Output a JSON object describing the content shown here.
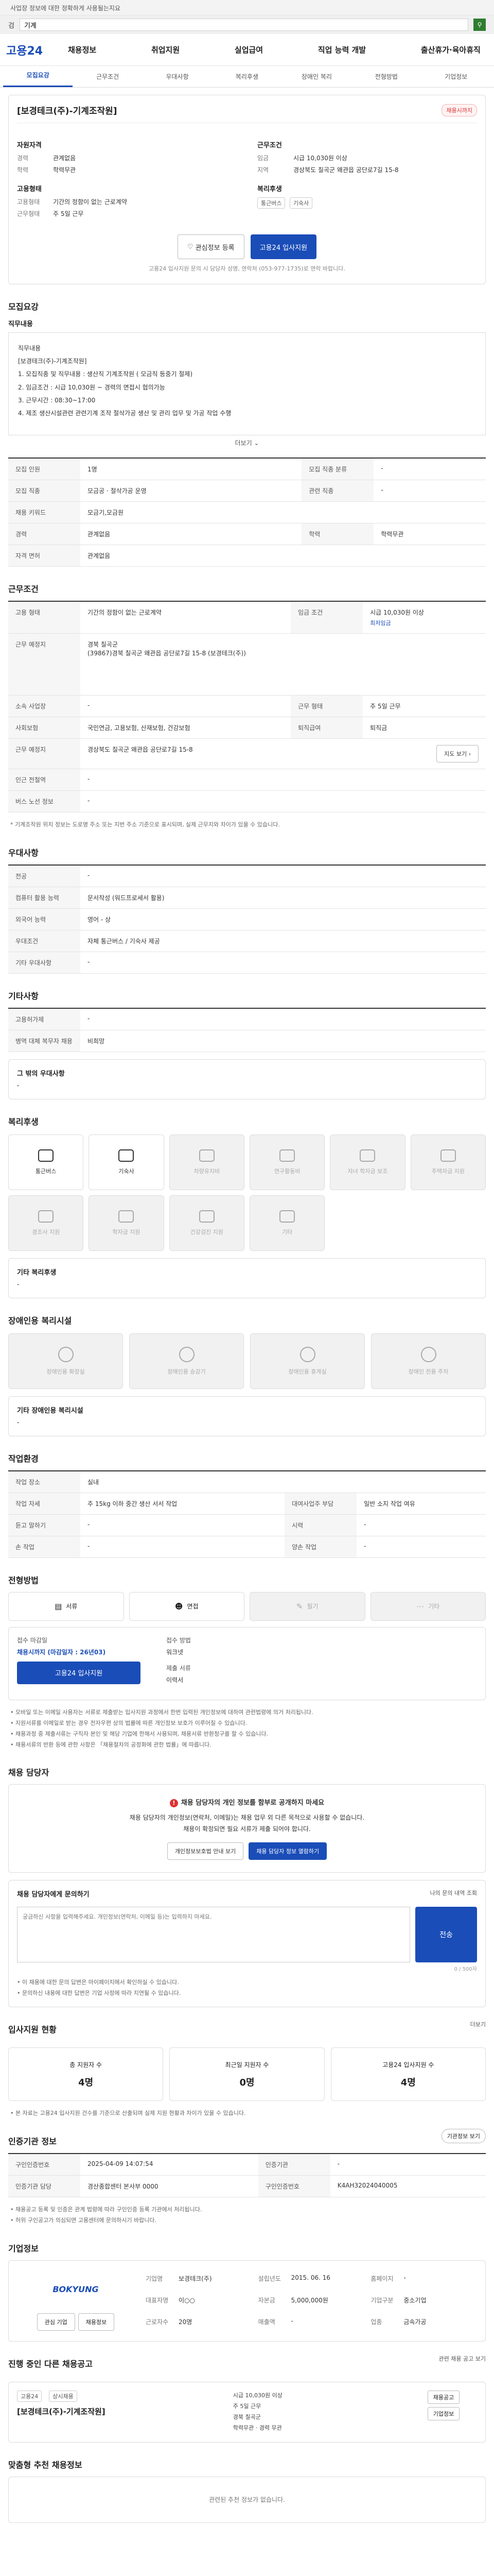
{
  "banner": {
    "text": "사업장 정보에 대한 정확하게 사용될는지요"
  },
  "search": {
    "label": "검",
    "value": "기계",
    "icon": "magnifier-icon"
  },
  "header": {
    "logo": "고용24",
    "menu": [
      "채용정보",
      "취업지원",
      "실업급여",
      "직업 능력 개발",
      "출산휴가·육아휴직"
    ]
  },
  "tabs": [
    "모집요강",
    "근무조건",
    "우대사항",
    "복리후생",
    "장애인 복리",
    "전형방법",
    "기업정보"
  ],
  "summary": {
    "title": "[보경테크(주)-기계조작원]",
    "deadline": "채용시까지",
    "left_heading": "자원자격",
    "left_rows": [
      {
        "k": "경력",
        "v": "관계없음"
      },
      {
        "k": "학력",
        "v": "학력무관"
      }
    ],
    "left_heading2": "고용형태",
    "left_rows2": [
      {
        "k": "고용형태",
        "v": "기간의 정함이 없는 근로계약"
      },
      {
        "k": "근무형태",
        "v": "주 5일 근무"
      }
    ],
    "right_heading": "근무조건",
    "right_rows": [
      {
        "k": "임금",
        "v": "시급 10,030원 이상"
      },
      {
        "k": "지역",
        "v": "경상북도 칠곡군 왜관읍 공단로7길 15-8"
      }
    ],
    "right_heading2": "복리후생",
    "badges": [
      "통근버스",
      "기숙사"
    ],
    "btn_scrap": "관심정보 등록",
    "btn_apply": "고용24 입사지원",
    "note": "고용24 입사지원 문의 시 담당자 성명, 연락처 (053-977-1735)로 연락 바랍니다."
  },
  "recruit": {
    "title": "모집요강",
    "sub": "직무내용",
    "lines": [
      "직무내용",
      "[보경테크(주)-기계조작원]",
      "1. 모집직종 및 직무내용 : 생산직 기계조작원 ( 모금직 등중기 절제)",
      "2. 임금조건 : 시급 10,030원 ~ 경력의 면접시 협의가능",
      "3. 근무시간 : 08:30~17:00",
      "4. 제조 생산시설관련 관련기계 조작 절삭가공 생산 및 관리 업무 및 가공 작업 수행"
    ],
    "more": "더보기",
    "table": [
      {
        "k1": "모집 인원",
        "v1": "1명",
        "k2": "모집 직종 분류",
        "v2": "-"
      },
      {
        "k1": "모집 직종",
        "v1": "모금공 · 절삭가공 운영",
        "k2": "관련 직종",
        "v2": "-"
      },
      {
        "k1": "채용 키워드",
        "v1": "모금기,모금원",
        "k2": "",
        "v2": ""
      },
      {
        "k1": "경력",
        "v1": "관계없음",
        "k2": "학력",
        "v2": "학력무관"
      },
      {
        "k1": "자격 면허",
        "v1": "관계없음",
        "k2": "",
        "v2": ""
      }
    ]
  },
  "work": {
    "title": "근무조건",
    "table": [
      {
        "k1": "고용 형태",
        "v1": "기간의 정함이 없는 근로계약",
        "k2": "임금 조건",
        "v2": "시급 10,030원 이상",
        "v2b": "최저임금"
      },
      {
        "k1": "근무 예정지",
        "v1": "경북 칠곡군\n(39867)경북 칠곡군 왜관읍 공단로7길 15-8 (보경테크(주))",
        "k2": "",
        "v2": "",
        "v2b": ""
      },
      {
        "k1": "소속 사업장",
        "v1": "-",
        "k2": "근무 형태",
        "v2": "주 5일 근무",
        "v2b": ""
      },
      {
        "k1": "사회보험",
        "v1": "국민연금, 고용보험, 산재보험, 건강보험",
        "k2": "퇴직급여",
        "v2": "퇴직금",
        "v2b": ""
      },
      {
        "k1": "근무 예정지",
        "v1": "경상북도 칠곡군 왜관읍 공단로7길 15-8",
        "k2": "",
        "v2": "",
        "v2b": ""
      },
      {
        "k1": "인근 전철역",
        "v1": "-",
        "k2": "",
        "v2": "",
        "v2b": ""
      },
      {
        "k1": "버스 노선 정보",
        "v1": "-",
        "k2": "",
        "v2": "",
        "v2b": ""
      }
    ],
    "map_btn": "지도 보기",
    "footnote": "* 기계조작원 위치 정보는 도로명 주소 또는 지번 주소 기준으로 표시되며, 실제 근무지와 차이가 있을 수 있습니다."
  },
  "prefer": {
    "title": "우대사항",
    "table": [
      {
        "k": "전공",
        "v": "-"
      },
      {
        "k": "컴퓨터 활용 능력",
        "v": "문서작성 (워드프로세서 활용)"
      },
      {
        "k": "외국어 능력",
        "v": "영어 - 상"
      },
      {
        "k": "우대조건",
        "v": "자체 통근버스 / 기숙사 제공"
      },
      {
        "k": "기타 우대사항",
        "v": "-"
      }
    ]
  },
  "extra": {
    "title": "기타사항",
    "table": [
      {
        "k": "고용허가제",
        "v": "-"
      },
      {
        "k": "병역 대체 복무자 채용",
        "v": "비희망"
      }
    ],
    "more_title": "그 밖의 우대사항",
    "more_value": "-"
  },
  "benefits": {
    "title": "복리후생",
    "items": [
      {
        "label": "통근버스",
        "on": true
      },
      {
        "label": "기숙사",
        "on": true
      },
      {
        "label": "차량유지비",
        "on": false
      },
      {
        "label": "연구활동비",
        "on": false
      },
      {
        "label": "자녀 학자금 보조",
        "on": false
      },
      {
        "label": "주택자금 지원",
        "on": false
      },
      {
        "label": "경조사 지원",
        "on": false
      },
      {
        "label": "학자금 지원",
        "on": false
      },
      {
        "label": "건강검진 지원",
        "on": false
      },
      {
        "label": "기타",
        "on": false
      }
    ],
    "detail_title": "기타 복리후생",
    "detail_value": "-"
  },
  "disability": {
    "title": "장애인용 복리시설",
    "items": [
      "장애인용 화장실",
      "장애인용 승강기",
      "장애인용 휴게실",
      "장애인 전용 주차"
    ],
    "detail_title": "기타 장애인용 복리시설",
    "detail_value": "-"
  },
  "env": {
    "title": "작업환경",
    "table": [
      {
        "k1": "작업 장소",
        "v1": "실내",
        "k2": "",
        "v2": ""
      },
      {
        "k1": "작업 자세",
        "v1": "주 15kg 이하 중간 생산 서서 작업",
        "k2": "",
        "v2": ""
      },
      {
        "k1": "듣고 말하기",
        "v1": "-",
        "k2": "시력",
        "v2": "-"
      },
      {
        "k1": "손 작업",
        "v1": "-",
        "k2": "양손 작업",
        "v2": "-"
      }
    ],
    "right_rows": [
      {
        "k": "대여사업주 부담",
        "v": "일반 소지 작업 여유"
      }
    ]
  },
  "selection": {
    "title": "전형방법",
    "methods": [
      {
        "label": "서류",
        "icon": "document-icon",
        "on": true
      },
      {
        "label": "면접",
        "icon": "person-icon",
        "on": true
      },
      {
        "label": "필기",
        "icon": "pencil-icon",
        "on": false
      },
      {
        "label": "기타",
        "icon": "dots-icon",
        "on": false
      }
    ],
    "apply_label1": "접수 마감일",
    "apply_value1": "채용시까지 (마감일자 : 26년03)",
    "apply_label2": "접수 방법",
    "apply_value2": "워크넷",
    "apply_label3": "제출 서류",
    "apply_value3": "이력서",
    "apply_btn": "고용24 입사지원",
    "notes": [
      "• 모바일 또는 이메일 사용자는 서류로 제출받는 입사지원 과정에서 한번 입력된 개인정보에 대하여 관련법령에 의거 처리됩니다.",
      "• 지원서류를 이메일로 받는 경우 전자우편 상의 법률에 따른 개인정보 보호가 이루어질 수 있습니다.",
      "• 채용과정 중 제출서류는 구직자 본인 및 해당 기업에 한해서 사용되며, 채용서류 반환청구를 할 수 있습니다.",
      "• 채용서류의 반환 등에 관한 사항은 「채용절차의 공정화에 관한 법률」에 따릅니다."
    ]
  },
  "manager": {
    "title": "채용 담당자",
    "warn": "채용 담당자의 개인 정보를 함부로 공개하지 마세요",
    "desc1": "채용 담당자의 개인정보(연락처, 이메일)는 채용 업무 외 다른 목적으로 사용할 수 없습니다.",
    "desc2": "채용이 확정되면 필요 서류가 제출 되어야 합니다.",
    "btn1": "개인정보보호법 안내 보기",
    "btn2": "채용 담당자 정보 열람하기",
    "inq_title": "채용 담당자에게 문의하기",
    "inq_link": "나의 문의 내역 조회",
    "inq_placeholder": "궁금하신 사항을 입력해주세요. 개인정보(연락처, 이메일 등)는 입력하지 마세요.",
    "inq_btn": "전송",
    "inq_count": "0 / 500자",
    "inq_notes": [
      "• 이 채용에 대한 문의 답변은 마이페이지에서 확인하실 수 있습니다.",
      "• 문의하신 내용에 대한 답변은 기업 사정에 따라 지연될 수 있습니다."
    ]
  },
  "stats": {
    "title": "입사지원 현황",
    "link": "더보기",
    "items": [
      {
        "label": "총 지원자 수",
        "value": "4명"
      },
      {
        "label": "최근일 지원자 수",
        "value": "0명"
      },
      {
        "label": "고용24 입사지원 수",
        "value": "4명"
      }
    ],
    "note": "• 본 자료는 고용24 입사지원 건수를 기준으로 산출되며 실제 지원 현황과 차이가 있을 수 있습니다."
  },
  "org": {
    "title": "인증기관 정보",
    "btn": "기관정보 보기",
    "table": [
      {
        "k1": "구인인증번호",
        "v1": "2025-04-09 14:07:54",
        "k2": "인증기관",
        "v2": "-"
      },
      {
        "k1": "인증기관 담당",
        "v1": "경산종합센터 본사부 0000",
        "k2": "",
        "v2": ""
      }
    ],
    "ref_label": "구인인증번호",
    "ref_value": "K4AH32024040005",
    "notes": [
      "• 채용공고 등록 및 인증은 관계 법령에 따라 구인인증 등록 기관에서 처리됩니다.",
      "• 허위 구인공고가 의심되면 고용센터에 문의하시기 바랍니다."
    ]
  },
  "company": {
    "title": "기업정보",
    "logo_text": "BOKYUNG",
    "btn1": "관심 기업",
    "btn2": "채용정보",
    "rows": [
      {
        "k": "기업명",
        "v": "보경테크(주)"
      },
      {
        "k": "대표자명",
        "v": "이○○"
      },
      {
        "k": "근로자수",
        "v": "20명"
      },
      {
        "k": "업종",
        "v": "금속가공"
      },
      {
        "k": "설립년도",
        "v": "2015. 06. 16"
      },
      {
        "k": "자본금",
        "v": "5,000,000원"
      },
      {
        "k": "매출액",
        "v": "-"
      },
      {
        "k": "홈페이지",
        "v": "-"
      },
      {
        "k": "기업구분",
        "v": "중소기업"
      }
    ]
  },
  "related": {
    "title": "진행 중인 다른 채용공고",
    "link": "관련 채용 공고 보기",
    "tags": [
      "고용24",
      "상시채용"
    ],
    "job": "[보경테크(주)-기계조작원]",
    "mid": [
      "시급 10,030원 이상",
      "주 5일 근무",
      "경북 칠곡군",
      "학력무관 · 경력 무관"
    ],
    "btn1": "채용공고",
    "btn2": "기업정보",
    "empty_title": "맞춤형 추천 채용정보",
    "empty_text": "관련된 추천 정보가 없습니다."
  }
}
